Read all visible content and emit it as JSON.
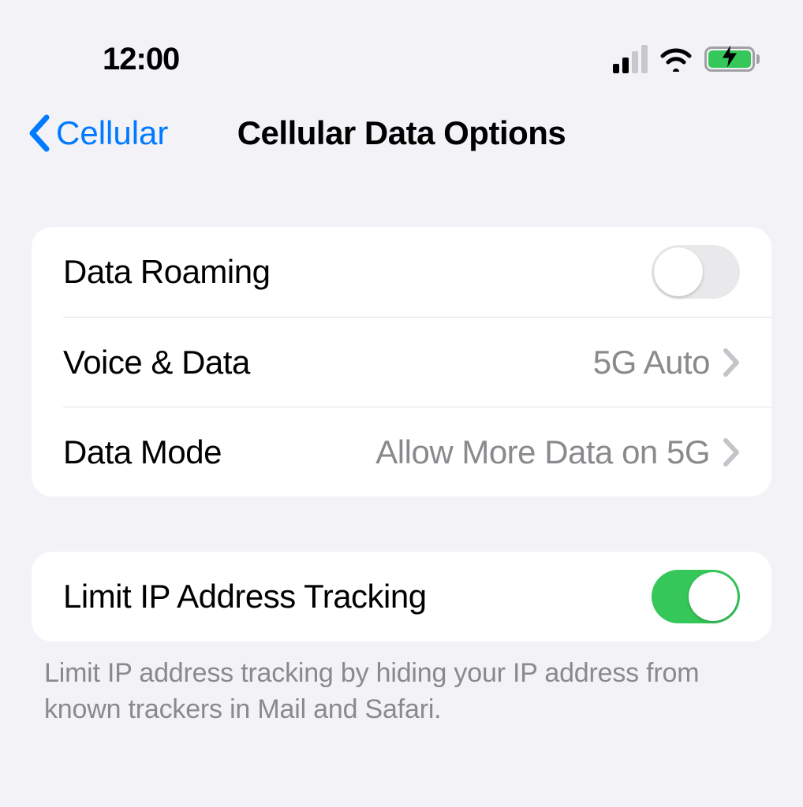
{
  "status": {
    "time": "12:00"
  },
  "nav": {
    "back_label": "Cellular",
    "title": "Cellular Data Options"
  },
  "section1": {
    "data_roaming": {
      "label": "Data Roaming",
      "on": false
    },
    "voice_data": {
      "label": "Voice & Data",
      "value": "5G Auto"
    },
    "data_mode": {
      "label": "Data Mode",
      "value": "Allow More Data on 5G"
    }
  },
  "section2": {
    "limit_ip": {
      "label": "Limit IP Address Tracking",
      "on": true
    },
    "footer": "Limit IP address tracking by hiding your IP address from known trackers in Mail and Safari."
  }
}
